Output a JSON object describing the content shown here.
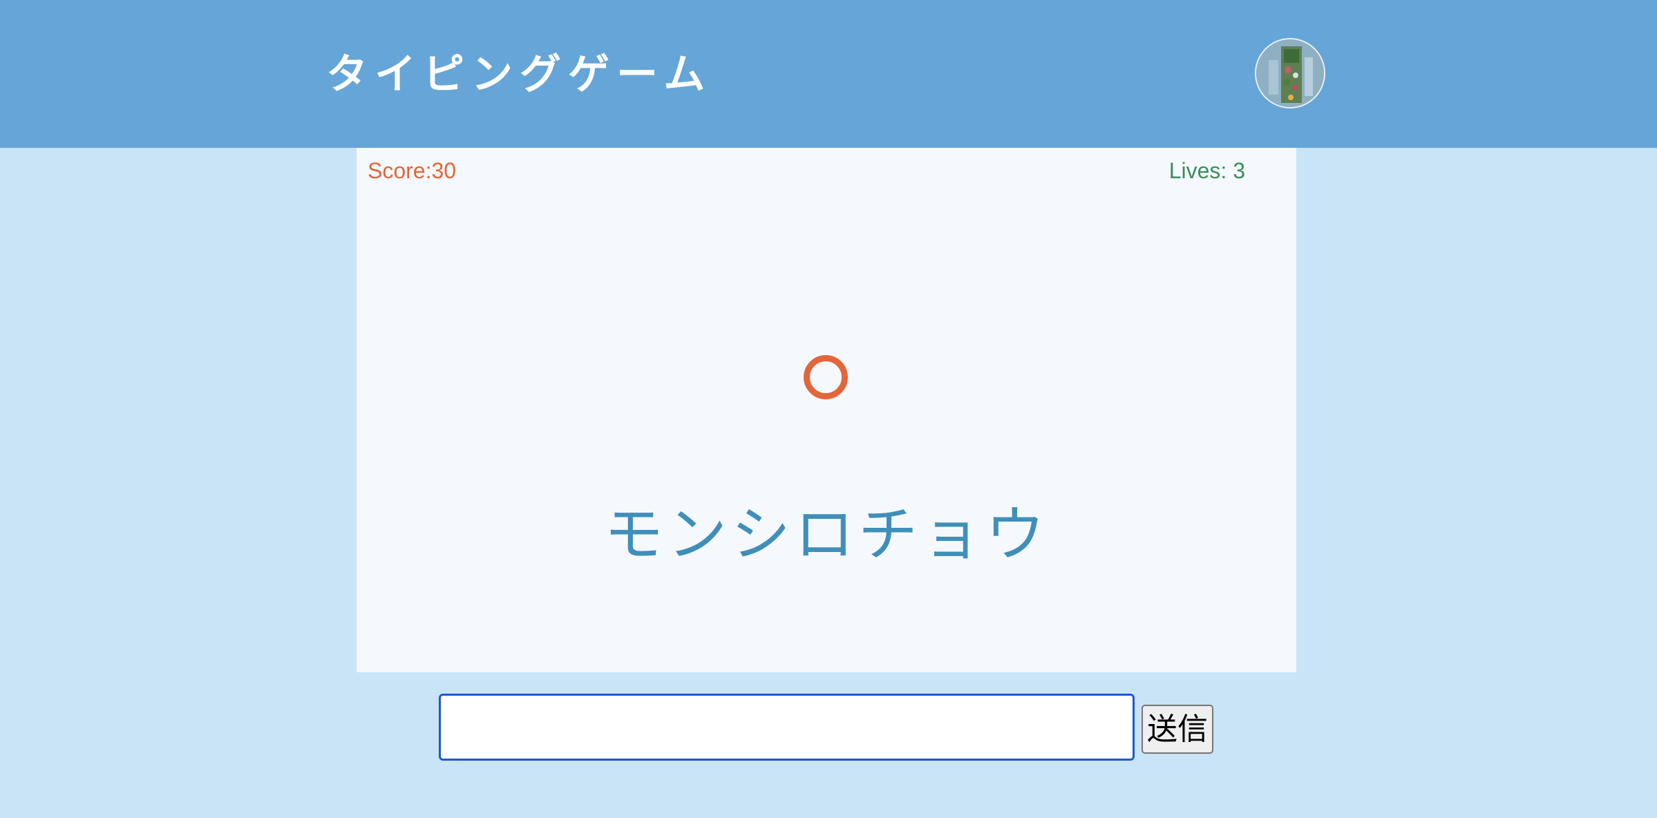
{
  "header": {
    "title": "タイピングゲーム",
    "avatar_icon": "user-avatar-icon"
  },
  "game": {
    "score_text": "Score:30",
    "lives_text": "Lives: 3",
    "score": 30,
    "lives": 3,
    "word": "モンシロチョウ",
    "marker_icon": "target-ring-icon"
  },
  "form": {
    "input_value": "",
    "input_placeholder": "",
    "submit_label": "送信"
  },
  "colors": {
    "header_bg": "#66a5d7",
    "page_bg": "#c8e4f6",
    "game_bg": "#f5f9fd",
    "score": "#e2663a",
    "lives": "#3b8e5c",
    "word": "#3f8fba",
    "ring": "#e2663a",
    "input_border": "#1a5bd0"
  }
}
